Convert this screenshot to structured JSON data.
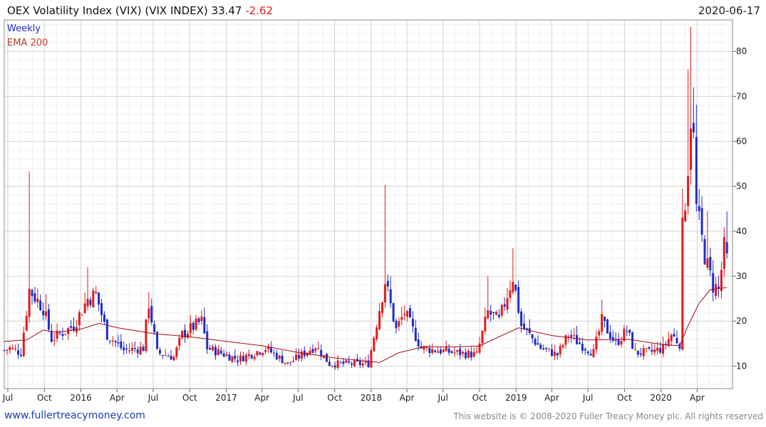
{
  "header": {
    "title": "OEX Volatility Index (VIX) (VIX INDEX)",
    "last": "33.47",
    "change": "-2.62",
    "date": "2020-06-17"
  },
  "footer": {
    "site": "www.fullertreacymoney.com",
    "copyright": "This website is © 2008-2020 Fuller Treacy Money plc. All rights reserved"
  },
  "colors": {
    "up": "#1f2fc9",
    "down": "#e31a1c",
    "ema": "#a50f15",
    "grid": "#dddddd"
  },
  "chart_data": {
    "type": "candlestick",
    "legend": [
      {
        "label": "Weekly",
        "color": "#1f2fc9"
      },
      {
        "label": "EMA 200",
        "color": "#c0392b"
      }
    ],
    "ylim": [
      5,
      87
    ],
    "y_ticks": [
      10,
      20,
      30,
      40,
      50,
      60,
      70,
      80
    ],
    "xlim": [
      "2015-06-22",
      "2020-06-29"
    ],
    "x_ticks": [
      {
        "date": "2015-07-01",
        "label": "Jul"
      },
      {
        "date": "2015-10-01",
        "label": "Oct"
      },
      {
        "date": "2016-01-01",
        "label": "2016"
      },
      {
        "date": "2016-04-01",
        "label": "Apr"
      },
      {
        "date": "2016-07-01",
        "label": "Jul"
      },
      {
        "date": "2016-10-01",
        "label": "Oct"
      },
      {
        "date": "2017-01-01",
        "label": "2017"
      },
      {
        "date": "2017-04-01",
        "label": "Apr"
      },
      {
        "date": "2017-07-01",
        "label": "Jul"
      },
      {
        "date": "2017-10-01",
        "label": "Oct"
      },
      {
        "date": "2018-01-01",
        "label": "2018"
      },
      {
        "date": "2018-04-01",
        "label": "Apr"
      },
      {
        "date": "2018-07-01",
        "label": "Jul"
      },
      {
        "date": "2018-10-01",
        "label": "Oct"
      },
      {
        "date": "2019-01-01",
        "label": "2019"
      },
      {
        "date": "2019-04-01",
        "label": "Apr"
      },
      {
        "date": "2019-07-01",
        "label": "Jul"
      },
      {
        "date": "2019-10-01",
        "label": "Oct"
      },
      {
        "date": "2020-01-01",
        "label": "2020"
      },
      {
        "date": "2020-04-01",
        "label": "Apr"
      }
    ],
    "anchors": [
      [
        "2015-06-22",
        13.5
      ],
      [
        "2015-07-06",
        14
      ],
      [
        "2015-08-03",
        13
      ],
      [
        "2015-08-24",
        27
      ],
      [
        "2015-09-28",
        23
      ],
      [
        "2015-10-19",
        16
      ],
      [
        "2015-12-14",
        19
      ],
      [
        "2016-01-18",
        25
      ],
      [
        "2016-02-08",
        26
      ],
      [
        "2016-03-07",
        17
      ],
      [
        "2016-04-18",
        13.5
      ],
      [
        "2016-06-06",
        14
      ],
      [
        "2016-06-20",
        24
      ],
      [
        "2016-07-11",
        13
      ],
      [
        "2016-08-22",
        12
      ],
      [
        "2016-09-12",
        17
      ],
      [
        "2016-10-31",
        20
      ],
      [
        "2016-11-14",
        14
      ],
      [
        "2017-01-30",
        11.5
      ],
      [
        "2017-04-10",
        14
      ],
      [
        "2017-06-05",
        10.5
      ],
      [
        "2017-08-14",
        14.5
      ],
      [
        "2017-09-18",
        10.5
      ],
      [
        "2017-12-25",
        10.5
      ],
      [
        "2018-02-05",
        29
      ],
      [
        "2018-03-05",
        18
      ],
      [
        "2018-03-26",
        22
      ],
      [
        "2018-05-07",
        14
      ],
      [
        "2018-07-30",
        13
      ],
      [
        "2018-09-24",
        12.5
      ],
      [
        "2018-10-22",
        22
      ],
      [
        "2018-11-19",
        20
      ],
      [
        "2018-12-24",
        30
      ],
      [
        "2019-01-14",
        19
      ],
      [
        "2019-03-04",
        14
      ],
      [
        "2019-04-15",
        12.5
      ],
      [
        "2019-05-13",
        17
      ],
      [
        "2019-06-10",
        15
      ],
      [
        "2019-07-15",
        13
      ],
      [
        "2019-08-05",
        20
      ],
      [
        "2019-09-09",
        15
      ],
      [
        "2019-10-07",
        18
      ],
      [
        "2019-10-28",
        13
      ],
      [
        "2019-12-02",
        13
      ],
      [
        "2020-01-06",
        14
      ],
      [
        "2020-01-27",
        17
      ],
      [
        "2020-02-17",
        15
      ],
      [
        "2020-02-24",
        40
      ],
      [
        "2020-03-09",
        55
      ],
      [
        "2020-03-16",
        66
      ],
      [
        "2020-03-23",
        60
      ],
      [
        "2020-03-30",
        45
      ],
      [
        "2020-04-13",
        38
      ],
      [
        "2020-04-27",
        32
      ],
      [
        "2020-05-11",
        28
      ],
      [
        "2020-05-25",
        27
      ],
      [
        "2020-06-08",
        36
      ],
      [
        "2020-06-15",
        33.5
      ]
    ],
    "spikes": [
      [
        "2015-08-24",
        53.3
      ],
      [
        "2015-10-05",
        26
      ],
      [
        "2016-01-18",
        32
      ],
      [
        "2016-06-20",
        26.5
      ],
      [
        "2016-11-07",
        23
      ],
      [
        "2018-02-05",
        50.3
      ],
      [
        "2018-10-22",
        30
      ],
      [
        "2018-12-24",
        36.2
      ],
      [
        "2019-08-05",
        24.8
      ],
      [
        "2020-02-24",
        49.5
      ],
      [
        "2020-03-09",
        76
      ],
      [
        "2020-03-16",
        85.5
      ],
      [
        "2020-03-23",
        72
      ],
      [
        "2020-04-27",
        44.5
      ],
      [
        "2020-06-15",
        44.4
      ]
    ],
    "ema": [
      [
        "2015-06-22",
        15.5
      ],
      [
        "2015-08-17",
        15.8
      ],
      [
        "2015-09-28",
        18
      ],
      [
        "2015-11-02",
        17.5
      ],
      [
        "2016-01-04",
        18.3
      ],
      [
        "2016-02-15",
        19.5
      ],
      [
        "2016-04-04",
        18.5
      ],
      [
        "2016-07-04",
        17.2
      ],
      [
        "2016-10-03",
        16.5
      ],
      [
        "2017-01-02",
        15.5
      ],
      [
        "2017-04-03",
        14.5
      ],
      [
        "2017-07-03",
        13
      ],
      [
        "2017-10-02",
        11.8
      ],
      [
        "2018-01-22",
        10.8
      ],
      [
        "2018-03-12",
        13
      ],
      [
        "2018-05-14",
        14.3
      ],
      [
        "2018-08-13",
        14.3
      ],
      [
        "2018-10-01",
        14.5
      ],
      [
        "2019-01-07",
        18.5
      ],
      [
        "2019-04-01",
        16.8
      ],
      [
        "2019-07-01",
        15.8
      ],
      [
        "2019-10-07",
        16
      ],
      [
        "2020-01-06",
        14.8
      ],
      [
        "2020-02-17",
        14.5
      ],
      [
        "2020-03-09",
        19
      ],
      [
        "2020-04-06",
        24
      ],
      [
        "2020-05-04",
        27
      ],
      [
        "2020-06-15",
        27.5
      ]
    ]
  }
}
